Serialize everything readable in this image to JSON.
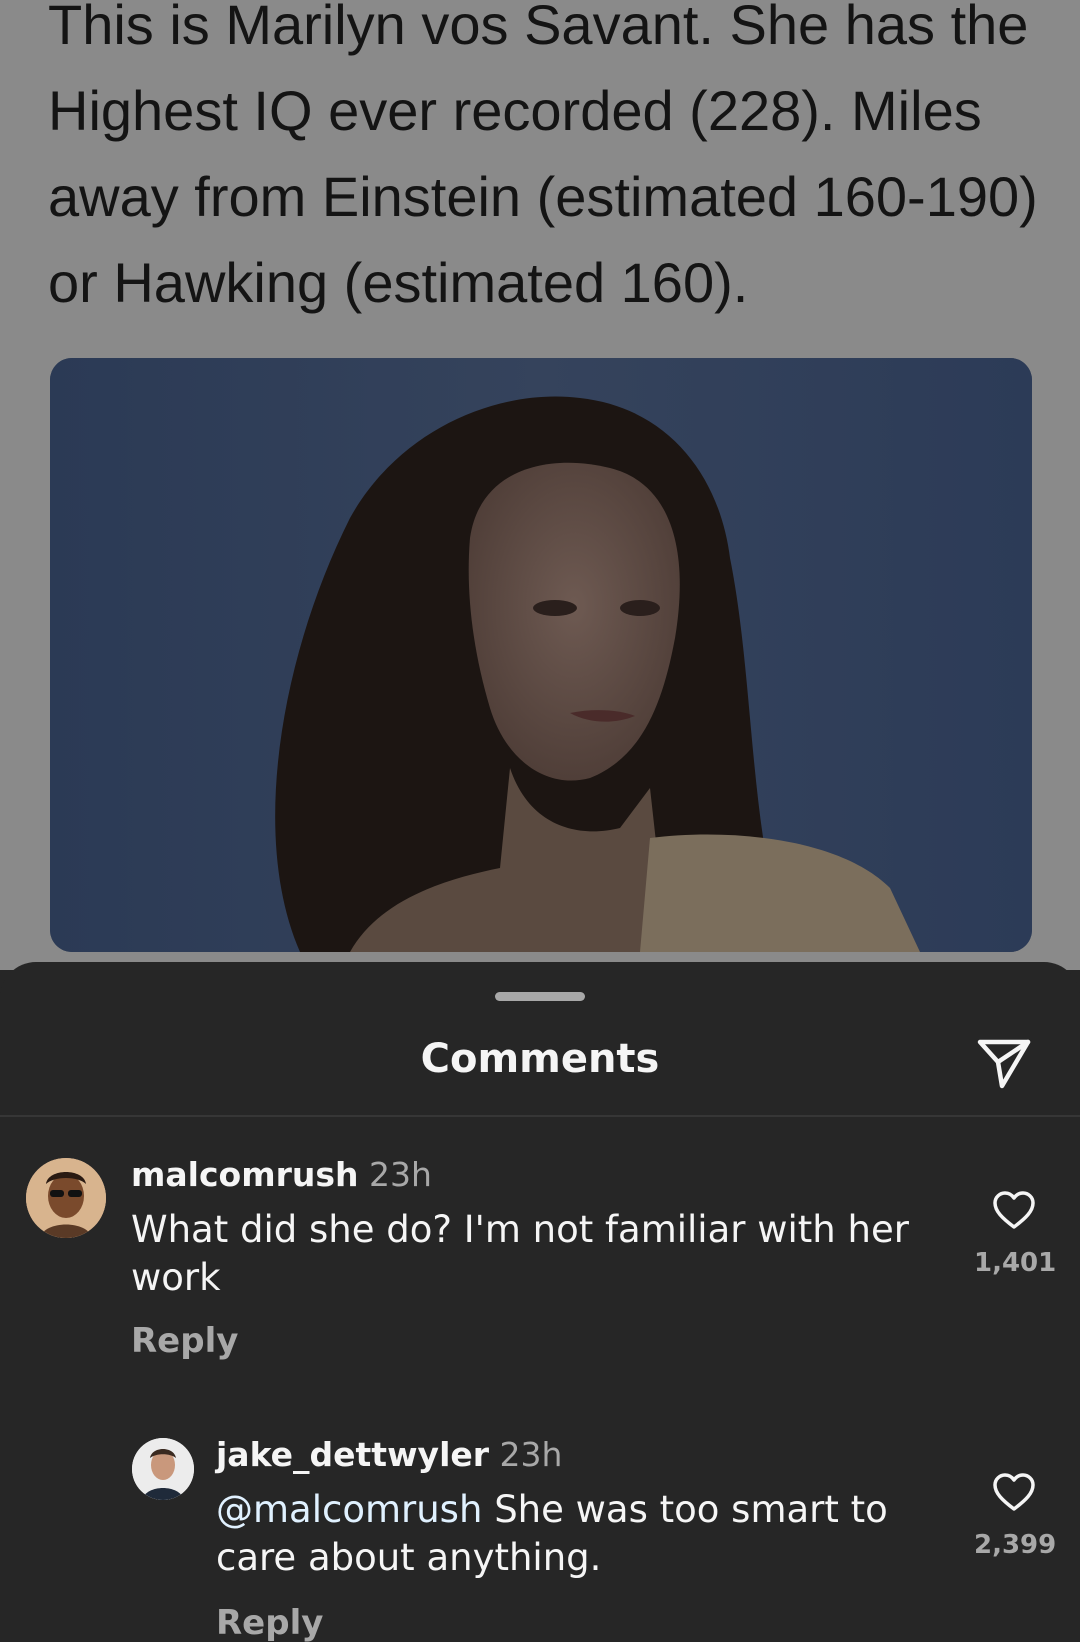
{
  "post": {
    "text": "This is Marilyn vos Savant. She has the Highest IQ ever recorded (228). Miles away from Einstein (estimated 160-190) or Hawking (estimated 160)."
  },
  "comments_sheet": {
    "title": "Comments",
    "share_icon": "paper-plane-icon",
    "comments": [
      {
        "username": "malcomrush",
        "time": "23h",
        "text": "What did she do? I'm not familiar with her work",
        "reply_label": "Reply",
        "like_icon": "heart-outline-icon",
        "likes": "1,401"
      },
      {
        "username": "jake_dettwyler",
        "time": "23h",
        "mention": "@malcomrush",
        "text": "She was too smart to care about anything.",
        "reply_label": "Reply",
        "like_icon": "heart-outline-icon",
        "likes": "2,399"
      }
    ]
  },
  "colors": {
    "sheet_background": "#262626",
    "primary_text": "#f5f5f5",
    "secondary_text": "#a8a8a8",
    "mention": "#e0f1ff",
    "dimmed_post_background": "#8a8a8a"
  }
}
